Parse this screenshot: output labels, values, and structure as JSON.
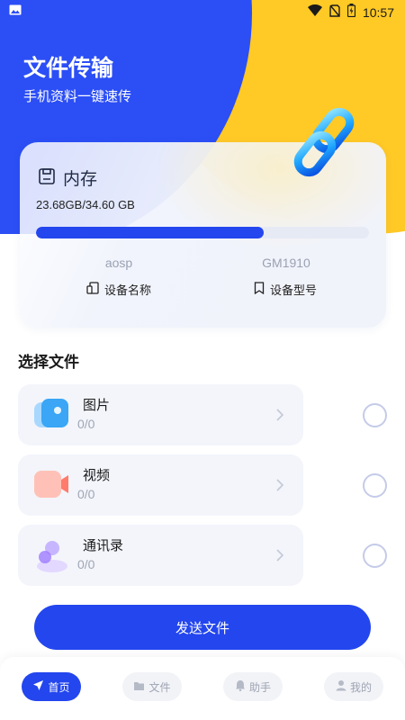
{
  "status_bar": {
    "time": "10:57"
  },
  "header": {
    "title": "文件传输",
    "subtitle": "手机资料一键速传"
  },
  "storage": {
    "label": "内存",
    "usage_text": "23.68GB/34.60 GB",
    "used_fraction": 0.6844,
    "device_name_value": "aosp",
    "device_name_label": "设备名称",
    "device_model_value": "GM1910",
    "device_model_label": "设备型号"
  },
  "select_section": {
    "title": "选择文件"
  },
  "file_types": [
    {
      "name": "图片",
      "count": "0/0",
      "icon": "image-icon"
    },
    {
      "name": "视频",
      "count": "0/0",
      "icon": "video-icon"
    },
    {
      "name": "通讯录",
      "count": "0/0",
      "icon": "contacts-icon"
    }
  ],
  "send_button": {
    "label": "发送文件"
  },
  "bottom_nav": [
    {
      "label": "首页",
      "icon": "send-icon",
      "active": true
    },
    {
      "label": "文件",
      "icon": "folder-icon",
      "active": false
    },
    {
      "label": "助手",
      "icon": "bell-icon",
      "active": false
    },
    {
      "label": "我的",
      "icon": "user-icon",
      "active": false
    }
  ],
  "colors": {
    "primary": "#2346EE",
    "accent_yellow": "#FFC926",
    "header_blue": "#2B4EF5"
  }
}
